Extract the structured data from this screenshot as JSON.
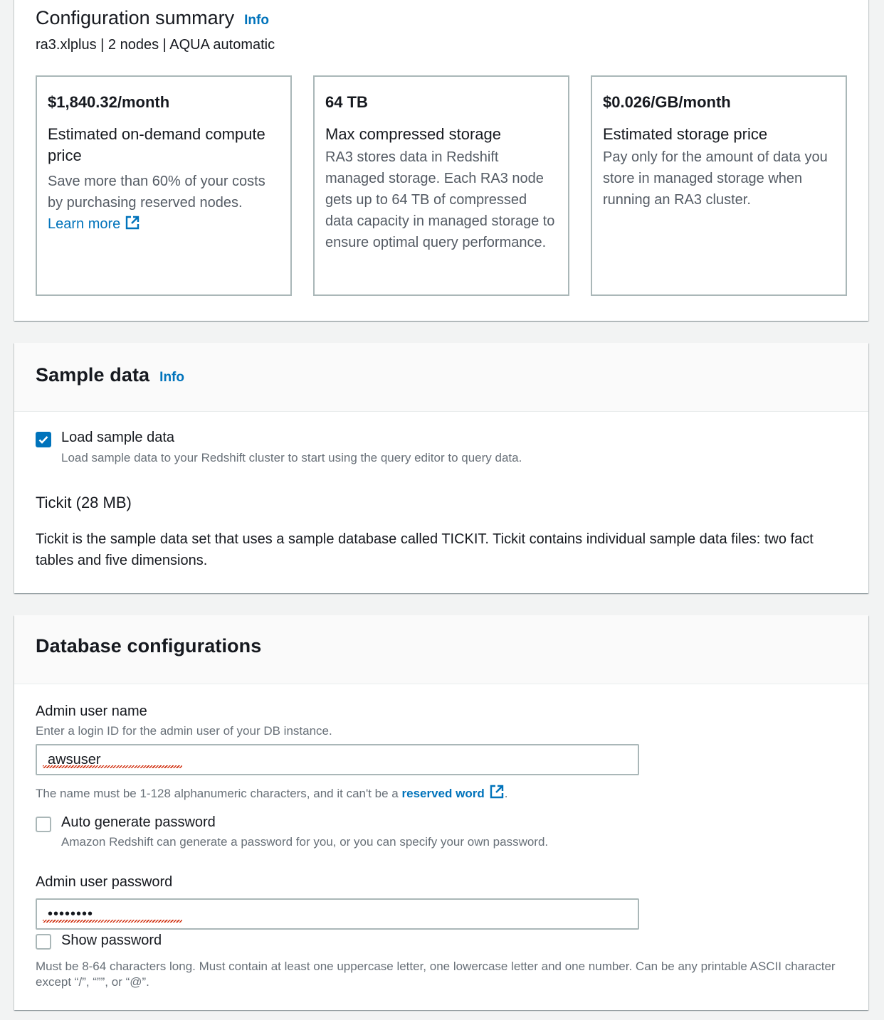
{
  "config_summary": {
    "title": "Configuration summary",
    "info": "Info",
    "subtitle": "ra3.xlplus | 2 nodes | AQUA automatic",
    "cards": [
      {
        "value": "$1,840.32/month",
        "label": "Estimated on-demand compute price",
        "description": "Save more than 60% of your costs by purchasing reserved nodes.",
        "link": "Learn more"
      },
      {
        "value": "64 TB",
        "label": "Max compressed storage",
        "description": "RA3 stores data in Redshift managed storage. Each RA3 node gets up to 64 TB of compressed data capacity in managed storage to ensure optimal query performance."
      },
      {
        "value": "$0.026/GB/month",
        "label": "Estimated storage price",
        "description": "Pay only for the amount of data you store in managed storage when running an RA3 cluster."
      }
    ]
  },
  "sample_data": {
    "title": "Sample data",
    "info": "Info",
    "checkbox_label": "Load sample data",
    "checkbox_desc": "Load sample data to your Redshift cluster to start using the query editor to query data.",
    "checked": true,
    "dataset_title": "Tickit (28 MB)",
    "dataset_desc": "Tickit is the sample data set that uses a sample database called TICKIT. Tickit contains individual sample data files: two fact tables and five dimensions."
  },
  "database_config": {
    "title": "Database configurations",
    "admin_user": {
      "label": "Admin user name",
      "description": "Enter a login ID for the admin user of your DB instance.",
      "value": "awsuser",
      "constraint_prefix": "The name must be 1-128 alphanumeric characters, and it can't be a",
      "constraint_link": "reserved word",
      "constraint_suffix": "."
    },
    "auto_password": {
      "label": "Auto generate password",
      "description": "Amazon Redshift can generate a password for you, or you can specify your own password.",
      "checked": false
    },
    "admin_password": {
      "label": "Admin user password",
      "value": "••••••••",
      "show_label": "Show password",
      "constraint": "Must be 8-64 characters long. Must contain at least one uppercase letter, one lowercase letter and one number. Can be any printable ASCII character except “/”, “””, or “@”."
    }
  },
  "colors": {
    "link": "#0073bb",
    "checkbox_checked": "#0073bb",
    "border": "#aab7b8",
    "spellcheck": "#d13212"
  }
}
